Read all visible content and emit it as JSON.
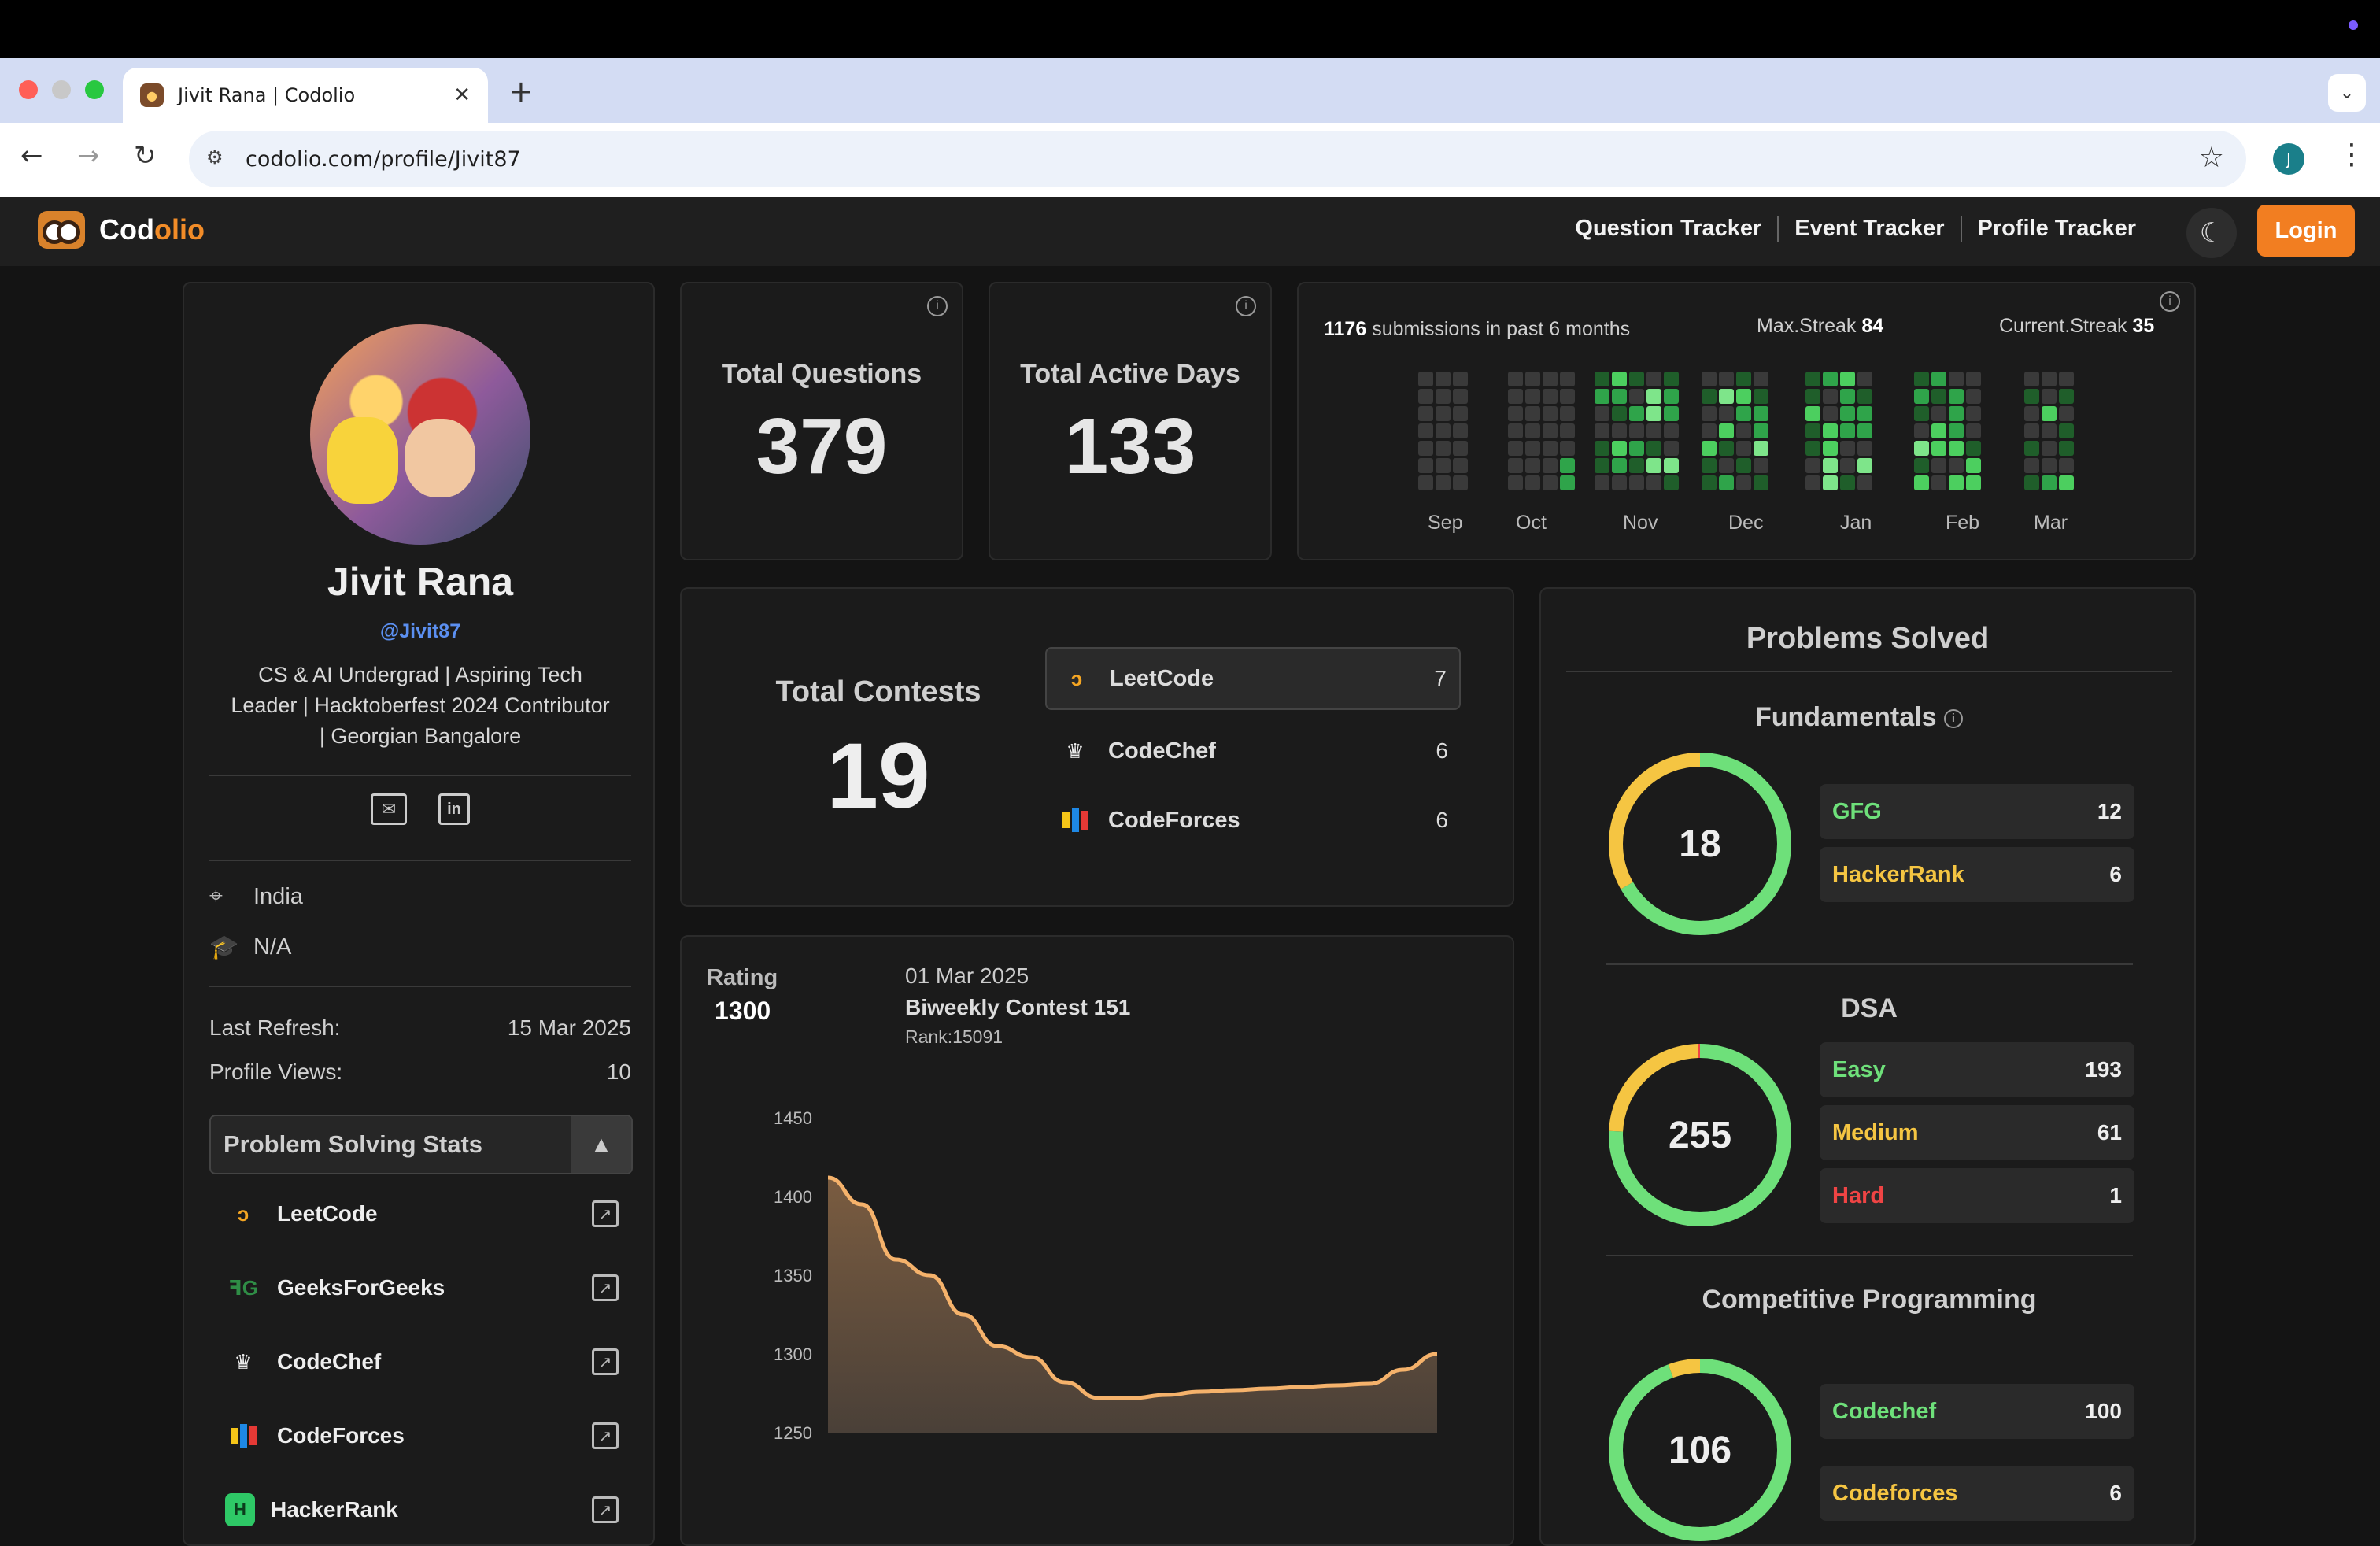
{
  "browser": {
    "tab_title": "Jivit Rana | Codolio",
    "url": "codolio.com/profile/Jivit87",
    "profile_initial": "J"
  },
  "nav": {
    "brand_a": "Cod",
    "brand_b": "olio",
    "links": [
      "Question Tracker",
      "Event Tracker",
      "Profile Tracker"
    ],
    "login": "Login"
  },
  "profile": {
    "name": "Jivit Rana",
    "handle": "@Jivit87",
    "bio": "CS & AI Undergrad | Aspiring Tech Leader | Hacktoberfest 2024 Contributor | Georgian Bangalore",
    "location": "India",
    "education": "N/A",
    "last_refresh_label": "Last Refresh:",
    "last_refresh": "15 Mar 2025",
    "views_label": "Profile Views:",
    "views": "10",
    "stats_title": "Problem Solving Stats",
    "platforms": [
      "LeetCode",
      "GeeksForGeeks",
      "CodeChef",
      "CodeForces",
      "HackerRank"
    ]
  },
  "stats": {
    "total_questions_label": "Total Questions",
    "total_questions": "379",
    "active_days_label": "Total Active Days",
    "active_days": "133"
  },
  "heatmap": {
    "submissions_count": "1176",
    "submissions_text": " submissions in past 6 months",
    "max_streak_label": "Max.Streak",
    "max_streak": "84",
    "current_streak_label": "Current.Streak",
    "current_streak": "35",
    "months": [
      "Sep",
      "Oct",
      "Nov",
      "Dec",
      "Jan",
      "Feb",
      "Mar"
    ]
  },
  "contests": {
    "label": "Total Contests",
    "total": "19",
    "rows": [
      {
        "name": "LeetCode",
        "count": "7"
      },
      {
        "name": "CodeChef",
        "count": "6"
      },
      {
        "name": "CodeForces",
        "count": "6"
      }
    ]
  },
  "rating": {
    "label": "Rating",
    "value": "1300",
    "date": "01 Mar 2025",
    "contest": "Biweekly Contest 151",
    "rank": "Rank:15091"
  },
  "chart_data": {
    "type": "area",
    "title": "",
    "xlabel": "",
    "ylabel": "",
    "ylim": [
      1250,
      1450
    ],
    "yticks": [
      1450,
      1400,
      1350,
      1300,
      1250
    ],
    "x": [
      0,
      1,
      2,
      3,
      4,
      5,
      6,
      7,
      8,
      9,
      10,
      11,
      12,
      13,
      14,
      15,
      16,
      17,
      18
    ],
    "values": [
      1412,
      1395,
      1360,
      1350,
      1325,
      1305,
      1298,
      1282,
      1272,
      1272,
      1274,
      1276,
      1277,
      1278,
      1279,
      1280,
      1281,
      1290,
      1300
    ],
    "color": "#f5b26b"
  },
  "solved": {
    "title": "Problems Solved",
    "fundamentals": {
      "label": "Fundamentals",
      "total": "18",
      "items": [
        {
          "name": "GFG",
          "count": "12",
          "color": "#6ee07a"
        },
        {
          "name": "HackerRank",
          "count": "6",
          "color": "#f5c542"
        }
      ],
      "fractions": [
        0.667,
        0.333
      ]
    },
    "dsa": {
      "label": "DSA",
      "total": "255",
      "items": [
        {
          "name": "Easy",
          "count": "193",
          "color": "#6ee07a"
        },
        {
          "name": "Medium",
          "count": "61",
          "color": "#f5c542"
        },
        {
          "name": "Hard",
          "count": "1",
          "color": "#ef4444"
        }
      ],
      "fractions": [
        0.757,
        0.239,
        0.004
      ]
    },
    "cp": {
      "label": "Competitive Programming",
      "total": "106",
      "items": [
        {
          "name": "Codechef",
          "count": "100",
          "color": "#6ee07a"
        },
        {
          "name": "Codeforces",
          "count": "6",
          "color": "#f5c542"
        }
      ],
      "fractions": [
        0.943,
        0.057
      ]
    }
  }
}
